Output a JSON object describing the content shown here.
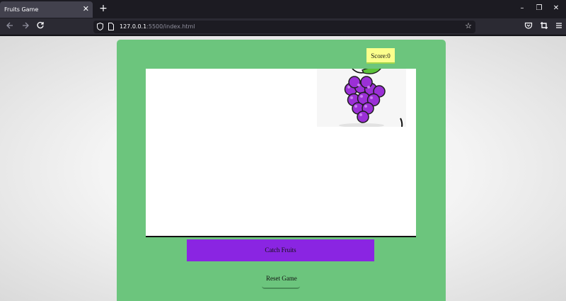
{
  "browser": {
    "tab": {
      "title": "Fruits Game",
      "close_glyph": "✕"
    },
    "new_tab_glyph": "+",
    "window_controls": {
      "minimize": "–",
      "restore": "❐",
      "close": "✕"
    },
    "url": {
      "host": "127.0.0.1",
      "rest": ":5500/index.html"
    },
    "icons": [
      "back-icon",
      "forward-icon",
      "reload-icon",
      "shield-icon",
      "page-icon",
      "star-icon",
      "pocket-icon",
      "extensions-icon",
      "menu-icon"
    ]
  },
  "game": {
    "score_label": "Score:0",
    "catch_button": "Catch Fruits",
    "reset_button": "Reset Game",
    "fruit": "grapes",
    "colors": {
      "panel": "#6cc57d",
      "score_bg": "#fbff8c",
      "catch_button": "#8a25e2",
      "grape": "#9b30d6",
      "leaf": "#5cc23a"
    }
  }
}
